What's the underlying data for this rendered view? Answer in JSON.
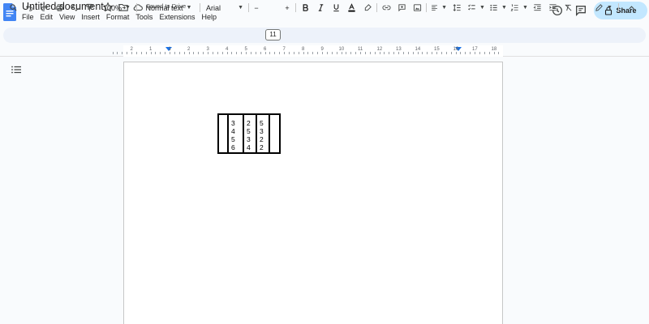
{
  "app": {
    "doc_title": "Untitled document",
    "saved_status": "Saved to Drive",
    "share_label": "Share"
  },
  "menu": [
    "File",
    "Edit",
    "View",
    "Insert",
    "Format",
    "Tools",
    "Extensions",
    "Help"
  ],
  "toolbar": {
    "zoom": "100%",
    "style": "Normal text",
    "font": "Arial",
    "font_size": "11",
    "minus": "−",
    "plus": "+"
  },
  "ruler": {
    "numbers": [
      "2",
      "1",
      "1",
      "2",
      "3",
      "4",
      "5",
      "6",
      "7",
      "8",
      "9",
      "10",
      "11",
      "12",
      "13",
      "14",
      "15",
      "16",
      "17",
      "18"
    ]
  },
  "table": {
    "columns": [
      [],
      [
        "3",
        "4",
        "5",
        "6"
      ],
      [
        "2",
        "5",
        "3",
        "4"
      ],
      [
        "5",
        "3",
        "2",
        "2"
      ],
      []
    ]
  },
  "colors": {
    "share_bg": "#c2e7ff",
    "toolbar_bg": "#edf2fa",
    "docs_blue": "#4285f4",
    "indent_blue": "#1a73e8"
  },
  "icons": [
    "docs-logo-icon",
    "star-icon",
    "move-folder-icon",
    "cloud-saved-icon",
    "history-icon",
    "comment-icon",
    "lock-icon",
    "search-icon",
    "undo-icon",
    "redo-icon",
    "print-icon",
    "spellcheck-icon",
    "paint-format-icon",
    "bold-icon",
    "italic-icon",
    "underline-icon",
    "text-color-icon",
    "highlight-icon",
    "link-icon",
    "add-comment-icon",
    "insert-image-icon",
    "align-icon",
    "line-spacing-icon",
    "checklist-icon",
    "bulleted-list-icon",
    "numbered-list-icon",
    "decrease-indent-icon",
    "increase-indent-icon",
    "clear-formatting-icon",
    "editing-mode-icon",
    "collapse-icon",
    "document-outline-icon"
  ]
}
